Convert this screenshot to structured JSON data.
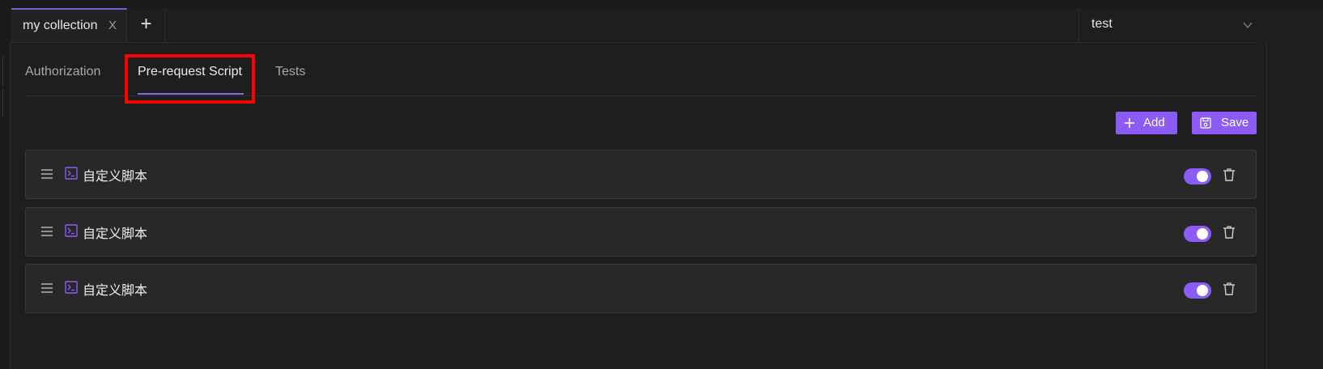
{
  "tabbar": {
    "tabs": [
      {
        "label": "my collection",
        "close": "X"
      }
    ],
    "add_label": "+",
    "environment": {
      "selected": "test"
    }
  },
  "subtabs": [
    {
      "label": "Authorization",
      "active": false
    },
    {
      "label": "Pre-request Script",
      "active": true
    },
    {
      "label": "Tests",
      "active": false
    }
  ],
  "toolbar": {
    "add_label": "Add",
    "save_label": "Save"
  },
  "scripts": [
    {
      "title": "自定义脚本",
      "enabled": true
    },
    {
      "title": "自定义脚本",
      "enabled": true
    },
    {
      "title": "自定义脚本",
      "enabled": true
    }
  ],
  "colors": {
    "accent": "#8b5cf6",
    "background": "#1e1e1f",
    "row_background": "#282829",
    "highlight": "#ff0000"
  }
}
